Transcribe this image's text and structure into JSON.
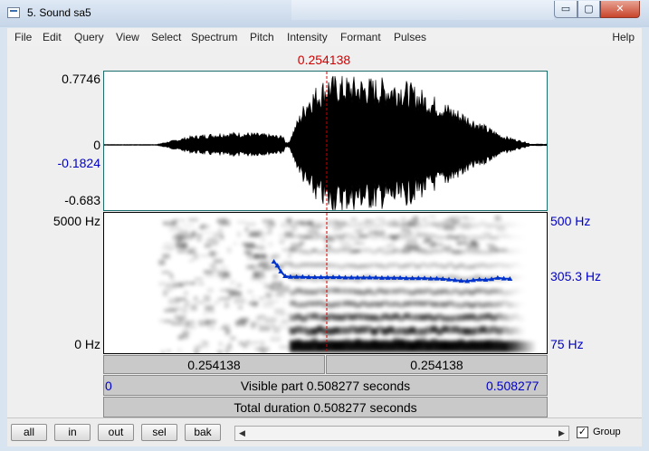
{
  "window": {
    "title": "5. Sound sa5",
    "min_glyph": "▭",
    "max_glyph": "▢",
    "close_glyph": "✕"
  },
  "menu": [
    "File",
    "Edit",
    "Query",
    "View",
    "Select",
    "Spectrum",
    "Pitch",
    "Intensity",
    "Formant",
    "Pulses"
  ],
  "menu_help": "Help",
  "cursor": {
    "time_label": "0.254138",
    "time": 0.254138
  },
  "waveform": {
    "max_label": "0.7746",
    "zero_label": "0",
    "cursor_value_label": "-0.1824",
    "min_label": "-0.683"
  },
  "spectrogram": {
    "freq_top_label": "5000 Hz",
    "freq_bottom_label": "0 Hz",
    "pitch_top_label": "500 Hz",
    "pitch_cursor_label": "305.3 Hz",
    "pitch_bottom_label": "75 Hz"
  },
  "pitch_track": [
    [
      0.195,
      352
    ],
    [
      0.199,
      340
    ],
    [
      0.203,
      322
    ],
    [
      0.208,
      308
    ],
    [
      0.214,
      306
    ],
    [
      0.221,
      306
    ],
    [
      0.228,
      306
    ],
    [
      0.235,
      305
    ],
    [
      0.242,
      305
    ],
    [
      0.249,
      305
    ],
    [
      0.256,
      305
    ],
    [
      0.263,
      305
    ],
    [
      0.27,
      305
    ],
    [
      0.277,
      304
    ],
    [
      0.284,
      304
    ],
    [
      0.291,
      304
    ],
    [
      0.298,
      304
    ],
    [
      0.305,
      304
    ],
    [
      0.312,
      304
    ],
    [
      0.319,
      303
    ],
    [
      0.326,
      303
    ],
    [
      0.333,
      303
    ],
    [
      0.34,
      303
    ],
    [
      0.347,
      302
    ],
    [
      0.354,
      302
    ],
    [
      0.361,
      302
    ],
    [
      0.368,
      302
    ],
    [
      0.375,
      301
    ],
    [
      0.382,
      301
    ],
    [
      0.389,
      300
    ],
    [
      0.396,
      298
    ],
    [
      0.403,
      296
    ],
    [
      0.41,
      294
    ],
    [
      0.417,
      293
    ],
    [
      0.424,
      296
    ],
    [
      0.431,
      298
    ],
    [
      0.438,
      297
    ],
    [
      0.445,
      299
    ],
    [
      0.452,
      303
    ],
    [
      0.459,
      301
    ],
    [
      0.466,
      300
    ]
  ],
  "time_bar": {
    "left_label": "0.254138",
    "right_label": "0.254138"
  },
  "visible_bar": {
    "start_label": "0",
    "text": "Visible part 0.508277 seconds",
    "end_label": "0.508277"
  },
  "total_bar": {
    "text": "Total duration 0.508277 seconds"
  },
  "buttons": {
    "all": "all",
    "in": "in",
    "out": "out",
    "sel": "sel",
    "bak": "bak"
  },
  "scroll": {
    "left_arrow": "◀",
    "right_arrow": "▶"
  },
  "group": {
    "label": "Group",
    "checked": true,
    "mark": "✓"
  },
  "colors": {
    "cursor": "#d00000",
    "pitch": "#0033cc",
    "label_blue": "#0000c8"
  }
}
